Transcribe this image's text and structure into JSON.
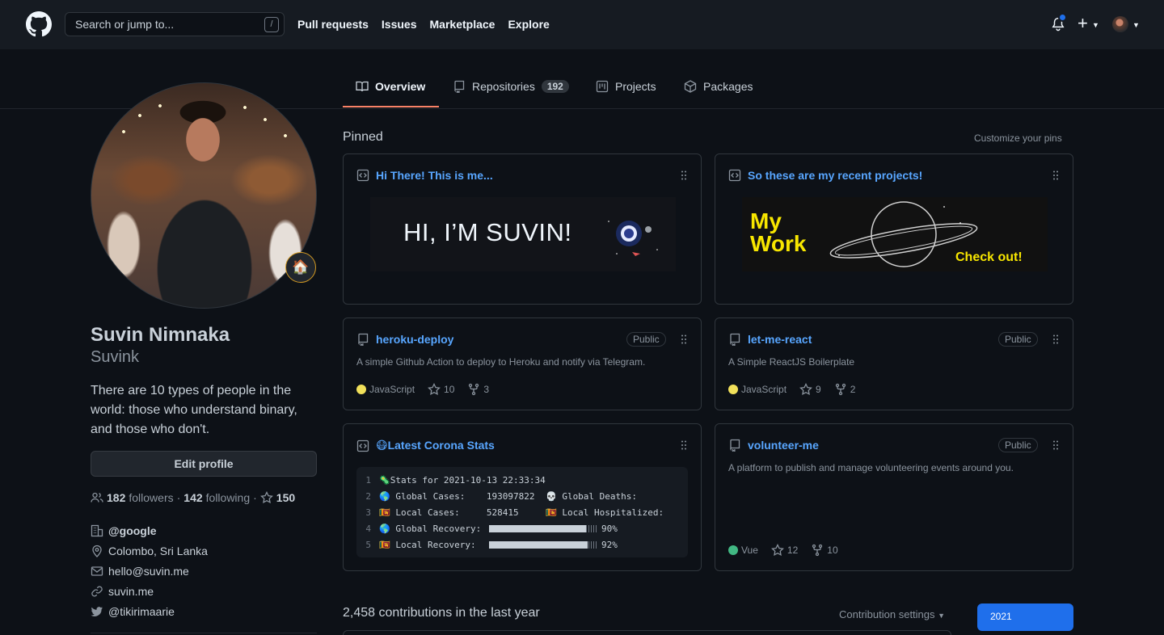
{
  "header": {
    "search_placeholder": "Search or jump to...",
    "search_shortcut": "/",
    "nav": [
      "Pull requests",
      "Issues",
      "Marketplace",
      "Explore"
    ],
    "new_label": "+"
  },
  "tabs": [
    {
      "label": "Overview",
      "icon": "book-icon",
      "active": true
    },
    {
      "label": "Repositories",
      "icon": "repo-icon",
      "count": "192"
    },
    {
      "label": "Projects",
      "icon": "project-icon"
    },
    {
      "label": "Packages",
      "icon": "package-icon"
    }
  ],
  "profile": {
    "name": "Suvin Nimnaka",
    "username": "Suvink",
    "status_emoji": "🏠",
    "bio": "There are 10 types of people in the world: those who understand binary, and those who don't.",
    "edit_label": "Edit profile",
    "followers": "182",
    "followers_label": "followers",
    "following": "142",
    "following_label": "following",
    "stars": "150",
    "sep": "·",
    "company": "@google",
    "location": "Colombo, Sri Lanka",
    "email": "hello@suvin.me",
    "website": "suvin.me",
    "twitter": "@tikirimaarie"
  },
  "pinned": {
    "title": "Pinned",
    "customize": "Customize your pins",
    "gist1": {
      "title": "Hi There! This is me...",
      "banner": "HI, I’M SUVIN!"
    },
    "gist2": {
      "title": "So these are my recent projects!",
      "banner_my": "My",
      "banner_work": "Work",
      "banner_check": "Check out!"
    },
    "repo1": {
      "title": "heroku-deploy",
      "badge": "Public",
      "desc": "A simple Github Action to deploy to Heroku and notify via Telegram.",
      "lang": "JavaScript",
      "lang_color": "#f1e05a",
      "stars": "10",
      "forks": "3"
    },
    "repo2": {
      "title": "let-me-react",
      "badge": "Public",
      "desc": "A Simple ReactJS Boilerplate",
      "lang": "JavaScript",
      "lang_color": "#f1e05a",
      "stars": "9",
      "forks": "2"
    },
    "gist3": {
      "title": "😷Latest Corona Stats",
      "lines": [
        {
          "n": "1",
          "a": "🦠Stats for 2021-10-13 22:33:34",
          "b": ""
        },
        {
          "n": "2",
          "a": "🌎 Global Cases:    193097822",
          "b": "💀 Global Deaths:"
        },
        {
          "n": "3",
          "a": "🇱🇰 Local Cases:     528415",
          "b": "🇱🇰 Local Hospitalized:"
        },
        {
          "n": "4",
          "a": "🌎 Global Recovery: ",
          "pct": "90%",
          "fill": 0.9
        },
        {
          "n": "5",
          "a": "🇱🇰 Local Recovery:  ",
          "pct": "92%",
          "fill": 0.92
        }
      ]
    },
    "repo3": {
      "title": "volunteer-me",
      "badge": "Public",
      "desc": "A platform to publish and manage volunteering events around you.",
      "lang": "Vue",
      "lang_color": "#41b883",
      "stars": "12",
      "forks": "10"
    }
  },
  "contributions": {
    "title": "2,458 contributions in the last year",
    "settings": "Contribution settings",
    "year": "2021"
  },
  "colors": {
    "accent": "#58a6ff",
    "tab_underline": "#f78166",
    "year_btn": "#1f6feb"
  }
}
